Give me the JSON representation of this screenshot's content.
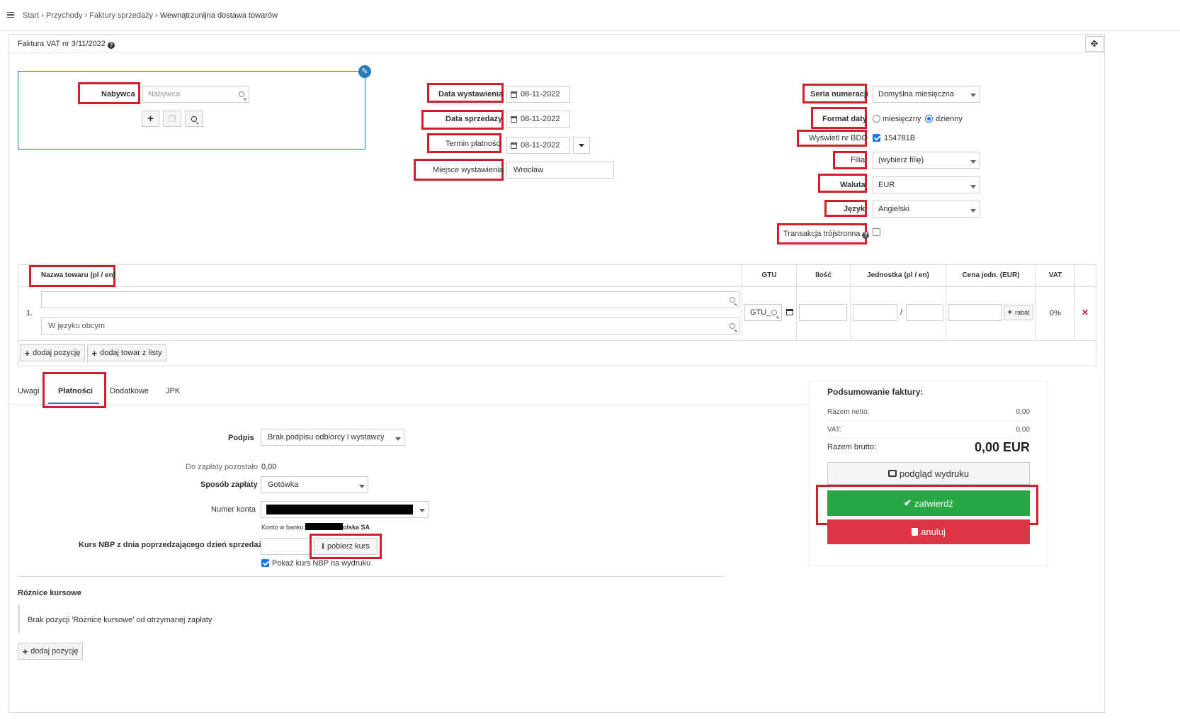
{
  "breadcrumb": {
    "items": [
      "Start",
      "Przychody",
      "Faktury sprzedaży",
      "Wewnątrzunijna dostawa towarów"
    ]
  },
  "panel": {
    "title": "Faktura VAT nr 3/11/2022"
  },
  "buyer": {
    "label": "Nabywca",
    "placeholder": "Nabywca"
  },
  "dates": {
    "issue_label": "Data wystawienia",
    "issue_value": "08-11-2022",
    "sale_label": "Data sprzedaży",
    "sale_value": "08-11-2022",
    "due_label": "Termin płatności",
    "due_value": "08-11-2022",
    "place_label": "Miejsce wystawienia",
    "place_value": "Wrocław"
  },
  "settings": {
    "series_label": "Seria numeracji",
    "series_value": "Domyślna miesięczna",
    "date_format_label": "Format daty",
    "date_format_monthly": "miesięczny",
    "date_format_daily": "dzienny",
    "bdo_label": "Wyświetl nr BDO",
    "bdo_value": "154781B",
    "branch_label": "Filia",
    "branch_value": "(wybierz filię)",
    "currency_label": "Waluta",
    "currency_value": "EUR",
    "language_label": "Język",
    "language_value": "Angielski",
    "triangular_label": "Transakcja trójstronna"
  },
  "items_table": {
    "headers": {
      "name": "Nazwa towaru (pl / en)",
      "gtu": "GTU",
      "qty": "Ilość",
      "unit": "Jednostka (pl / en)",
      "price": "Cena jedn. (EUR)",
      "vat": "VAT"
    },
    "row": {
      "index": "1.",
      "foreign_placeholder": "W języku obcym",
      "gtu_value": "GTU_",
      "unit_sep": "/",
      "rabat": "rabat",
      "vat": "0%"
    },
    "add_position": "dodaj pozycję",
    "add_from_list": "dodaj towar z listy"
  },
  "tabs": [
    {
      "label": "Uwagi"
    },
    {
      "label": "Płatności"
    },
    {
      "label": "Dodatkowe"
    },
    {
      "label": "JPK"
    }
  ],
  "payments": {
    "signature_label": "Podpis",
    "signature_value": "Brak podpisu odbiorcy i wystawcy",
    "remaining_label": "Do zapłaty pozostało",
    "remaining_value": "0,00",
    "method_label": "Sposób zapłaty",
    "method_value": "Gotówka",
    "account_label": "Numer konta",
    "bank_prefix": "Konto w banku:",
    "bank_suffix": "olska SA",
    "nbp_label": "Kurs NBP z dnia poprzedzającego dzień sprzedaży",
    "fetch_rate": "pobierz kurs",
    "show_rate_label": "Pokaż kurs NBP na wydruku"
  },
  "exchange_diff": {
    "title": "Różnice kursowe",
    "empty_text": "Brak pozycji 'Różnice kursowe' od otrzymanej zapłaty",
    "add_position": "dodaj pozycję"
  },
  "summary": {
    "title": "Podsumowanie faktury:",
    "net_label": "Razem netto:",
    "net_value": "0,00",
    "vat_label": "VAT:",
    "vat_value": "0,00",
    "gross_label": "Razem brutto:",
    "gross_value": "0,00 EUR",
    "preview": "podgląd wydruku",
    "confirm": "zatwierdź",
    "cancel": "anuluj"
  },
  "colors": {
    "highlight": "#d0202a",
    "confirm": "#28a745",
    "cancel": "#dc3545",
    "accent": "#1a73e8"
  }
}
